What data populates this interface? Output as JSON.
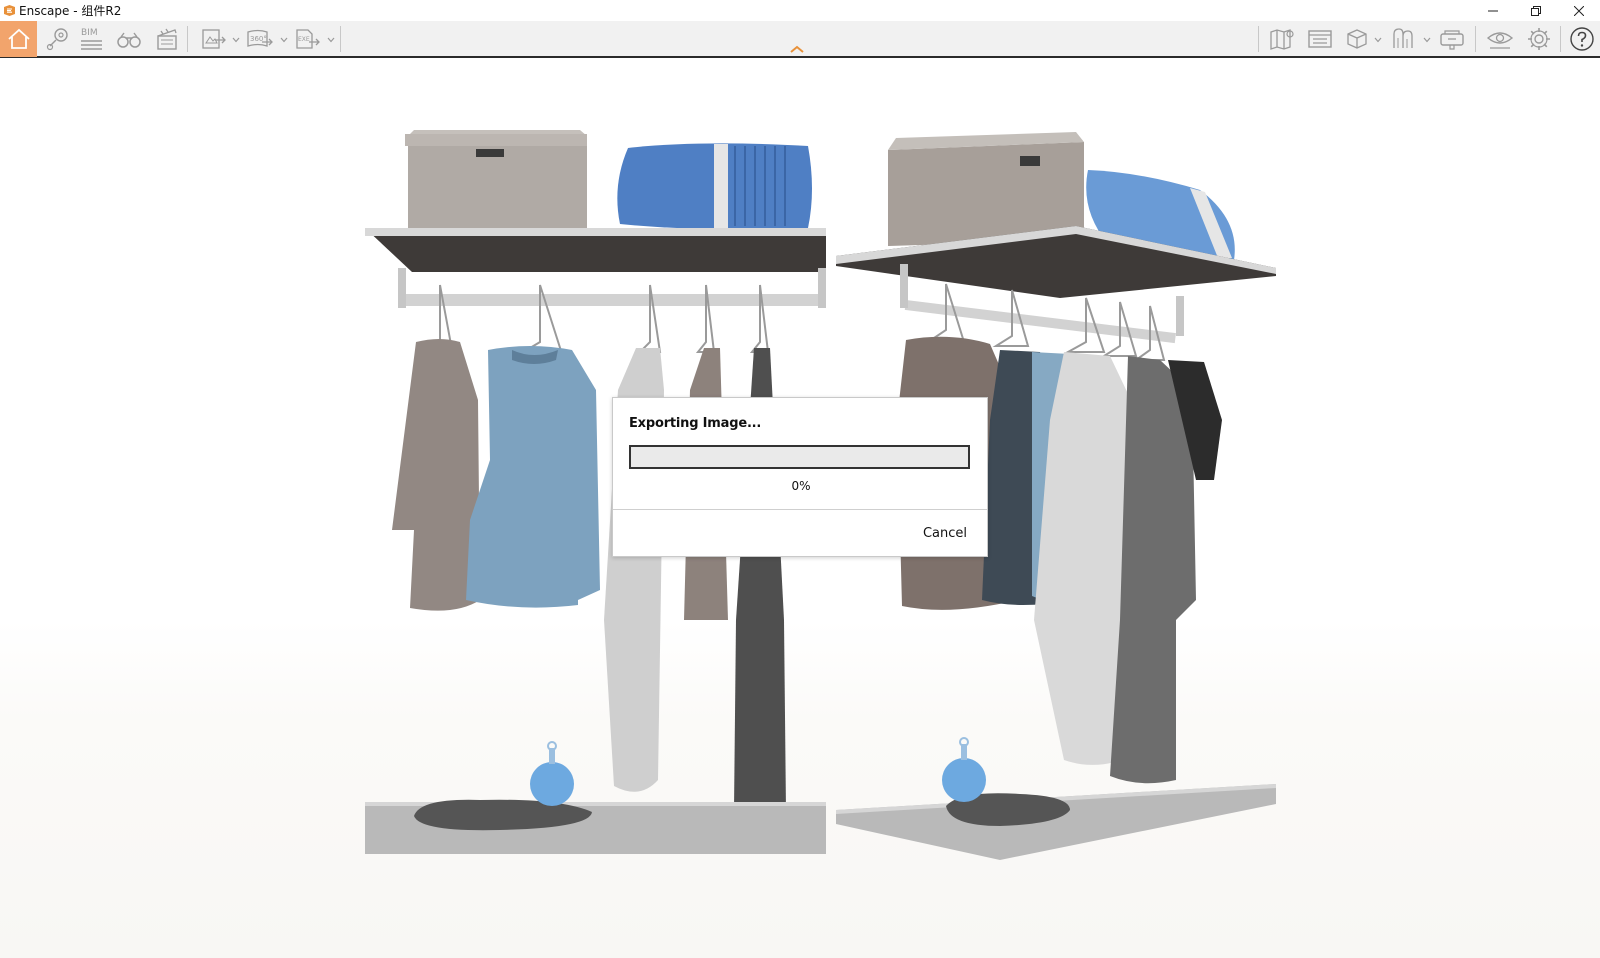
{
  "window": {
    "title": "Enscape - 组件R2",
    "controls": [
      "minimize-icon",
      "restore-icon",
      "close-icon"
    ]
  },
  "toolbar": {
    "left_icons": [
      "home-icon",
      "location-pin-icon",
      "bim-icon",
      "binoculars-icon",
      "clapperboard-icon",
      "screenshot-export-icon",
      "panorama-360-export-icon",
      "exe-export-icon"
    ],
    "bim_label": "BIM",
    "pano_label": "360°",
    "exe_label": "EXE",
    "right_icons": [
      "map-icon",
      "asset-library-icon",
      "cube-view-icon",
      "material-editor-icon",
      "vr-headset-icon",
      "visual-settings-icon",
      "settings-gear-icon",
      "help-icon"
    ],
    "accent_color": "#f2a46c"
  },
  "dialog": {
    "title": "Exporting Image...",
    "progress_percent": 0,
    "progress_text": "0%",
    "cancel_label": "Cancel"
  }
}
